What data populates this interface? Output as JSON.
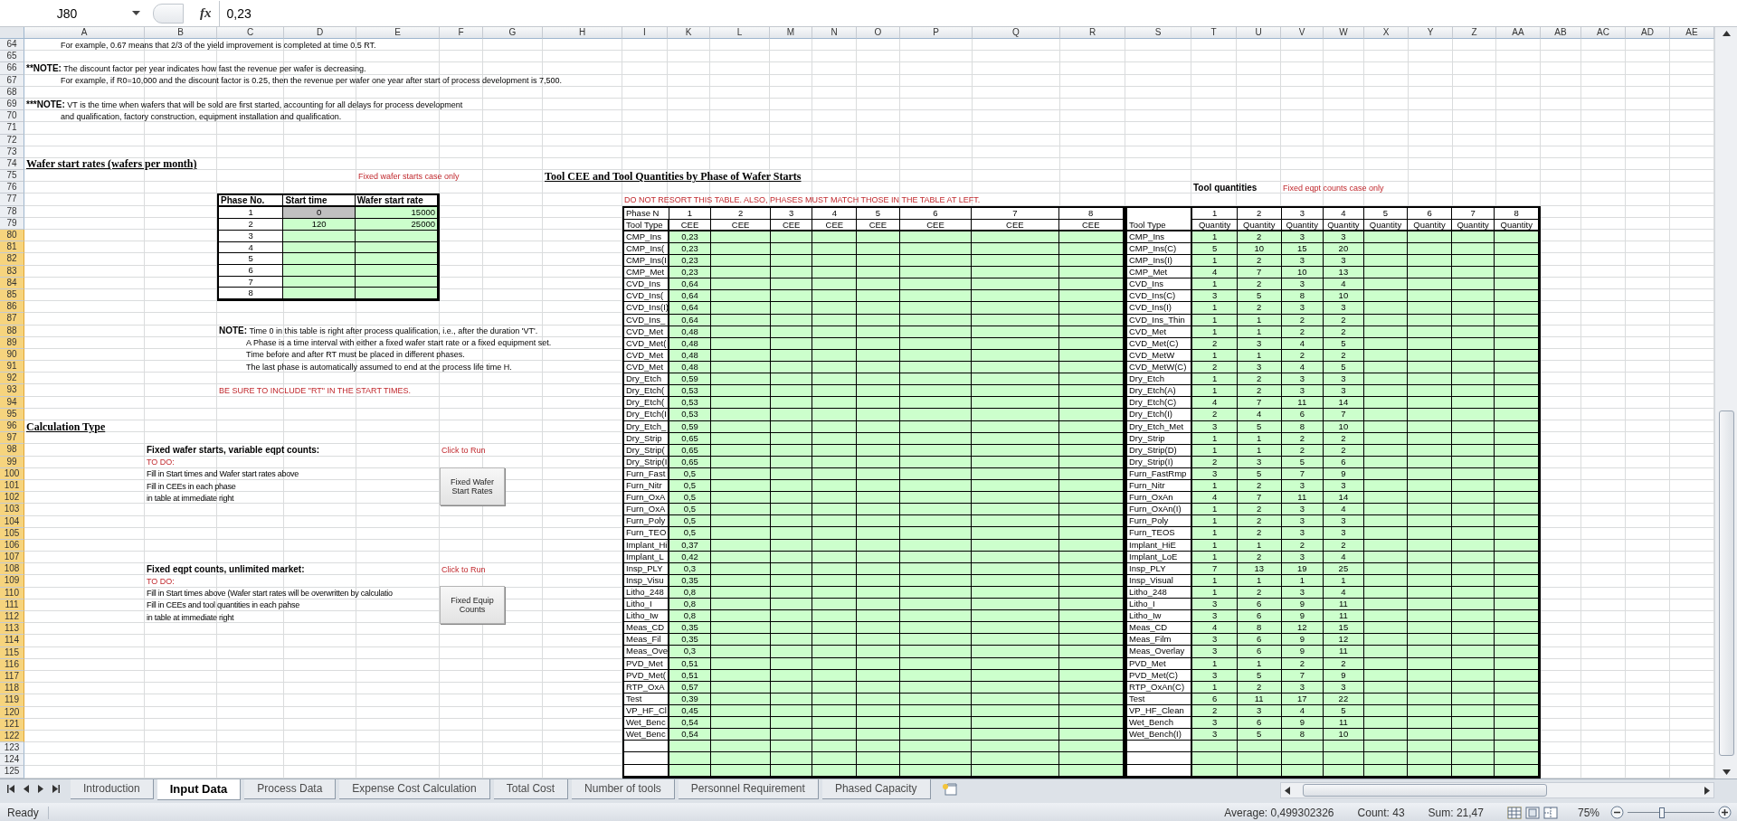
{
  "formula_bar": {
    "name_box": "J80",
    "function_label": "fx",
    "value": "0,23"
  },
  "columns": [
    "A",
    "B",
    "C",
    "D",
    "E",
    "F",
    "G",
    "H",
    "I",
    "K",
    "L",
    "M",
    "N",
    "O",
    "P",
    "Q",
    "R",
    "S",
    "T",
    "U",
    "V",
    "W",
    "X",
    "Y",
    "Z",
    "AA",
    "AB",
    "AC",
    "AD",
    "AE"
  ],
  "row_headers": [
    {
      "label": "64",
      "selected": false
    },
    {
      "label": "65",
      "selected": false
    },
    {
      "label": "66",
      "selected": false
    },
    {
      "label": "67",
      "selected": false
    },
    {
      "label": "68",
      "selected": false
    },
    {
      "label": "69",
      "selected": false
    },
    {
      "label": "70",
      "selected": false
    },
    {
      "label": "71",
      "selected": false
    },
    {
      "label": "72",
      "selected": false
    },
    {
      "label": "73",
      "selected": false
    },
    {
      "label": "74",
      "selected": false
    },
    {
      "label": "75",
      "selected": false
    },
    {
      "label": "76",
      "selected": false
    },
    {
      "label": "77",
      "selected": false
    },
    {
      "label": "78",
      "selected": false
    },
    {
      "label": "79",
      "selected": false
    },
    {
      "label": "80",
      "selected": true
    },
    {
      "label": "81",
      "selected": true
    },
    {
      "label": "82",
      "selected": true
    },
    {
      "label": "83",
      "selected": true
    },
    {
      "label": "84",
      "selected": true
    },
    {
      "label": "85",
      "selected": true
    },
    {
      "label": "86",
      "selected": true
    },
    {
      "label": "87",
      "selected": true
    },
    {
      "label": "88",
      "selected": true
    },
    {
      "label": "89",
      "selected": true
    },
    {
      "label": "90",
      "selected": true
    },
    {
      "label": "91",
      "selected": true
    },
    {
      "label": "92",
      "selected": true
    },
    {
      "label": "93",
      "selected": true
    },
    {
      "label": "94",
      "selected": true
    },
    {
      "label": "95",
      "selected": true
    },
    {
      "label": "96",
      "selected": true
    },
    {
      "label": "97",
      "selected": true
    },
    {
      "label": "98",
      "selected": true
    },
    {
      "label": "99",
      "selected": true
    },
    {
      "label": "100",
      "selected": true
    },
    {
      "label": "101",
      "selected": true
    },
    {
      "label": "102",
      "selected": true
    },
    {
      "label": "103",
      "selected": true
    },
    {
      "label": "104",
      "selected": true
    },
    {
      "label": "105",
      "selected": true
    },
    {
      "label": "106",
      "selected": true
    },
    {
      "label": "107",
      "selected": true
    },
    {
      "label": "108",
      "selected": true
    },
    {
      "label": "109",
      "selected": true
    },
    {
      "label": "110",
      "selected": true
    },
    {
      "label": "111",
      "selected": true
    },
    {
      "label": "112",
      "selected": true
    },
    {
      "label": "113",
      "selected": true
    },
    {
      "label": "114",
      "selected": true
    },
    {
      "label": "115",
      "selected": true
    },
    {
      "label": "116",
      "selected": true
    },
    {
      "label": "117",
      "selected": true
    },
    {
      "label": "118",
      "selected": true
    },
    {
      "label": "119",
      "selected": true
    },
    {
      "label": "120",
      "selected": true
    },
    {
      "label": "121",
      "selected": true
    },
    {
      "label": "122",
      "selected": true
    },
    {
      "label": "123",
      "selected": false
    },
    {
      "label": "124",
      "selected": false
    },
    {
      "label": "125",
      "selected": false
    }
  ],
  "notes": [
    {
      "kind": "indent",
      "text": "For example, 0.67 means that 2/3 of the yield improvement is completed at time 0.5 RT."
    },
    {
      "kind": "note",
      "mark": "**",
      "label": "NOTE:",
      "text": "The discount factor per year indicates how fast the revenue per wafer is decreasing."
    },
    {
      "kind": "indent",
      "text": "For example, if R0=10,000 and the discount factor is 0.25, then the revenue per wafer one year after start of process development is 7,500."
    },
    {
      "kind": "note",
      "mark": "***",
      "label": "NOTE:",
      "text": "VT is the time when wafers that will be sold are first started, accounting for all delays for process development"
    },
    {
      "kind": "indent",
      "text": "and qualification, factory construction, equipment installation and qualification."
    }
  ],
  "wafer_section": {
    "title": "Wafer start rates (wafers per month)",
    "case_note": "Fixed wafer starts case only",
    "table": {
      "columns": [
        "Phase No.",
        "Start time",
        "Wafer start rate"
      ],
      "rows": [
        {
          "phase": "1",
          "start": "0",
          "rate": "15000",
          "locked": true
        },
        {
          "phase": "2",
          "start": "120",
          "rate": "25000",
          "locked": false
        },
        {
          "phase": "3",
          "locked": false
        },
        {
          "phase": "4",
          "locked": false
        },
        {
          "phase": "5",
          "locked": false
        },
        {
          "phase": "6",
          "locked": false
        },
        {
          "phase": "7",
          "locked": false
        },
        {
          "phase": "8",
          "locked": false
        }
      ]
    },
    "note": {
      "label": "NOTE:",
      "lines": [
        "Time 0 in this table is right after process qualification, i.e., after the duration 'VT'.",
        "A Phase is a time interval with either a fixed wafer start rate or a fixed equipment set.",
        "Time before and after RT must be placed in different phases.",
        "The last phase is automatically assumed to end at the process life time H."
      ]
    },
    "warning": "BE SURE TO INCLUDE \"RT\" IN THE START TIMES."
  },
  "calculation": {
    "title": "Calculation Type",
    "cases": [
      {
        "title": "Fixed wafer starts, variable eqpt counts:",
        "run_label": "Click to Run",
        "todo": "TO DO:",
        "steps": [
          "Fill in Start times and Wafer start rates above",
          "Fill in CEEs in each phase",
          "in table at immediate right"
        ],
        "button": "Fixed Wafer Start Rates"
      },
      {
        "title": "Fixed eqpt counts, unlimited market:",
        "run_label": "Click to Run",
        "todo": "TO DO:",
        "steps": [
          "Fill in Start times above (Wafer start rates will be overwritten by calculatio",
          "Fill in CEEs and tool quantities in each pahse",
          "in table at immediate right"
        ],
        "button": "Fixed Equip Counts"
      }
    ]
  },
  "cee_section": {
    "title": "Tool CEE and Tool Quantities by Phase of Wafer Starts",
    "warning": "DO NOT RESORT THIS TABLE. ALSO, PHASES MUST MATCH THOSE IN THE TABLE AT LEFT.",
    "phase_label": "Phase N",
    "tool_label": "Tool Type",
    "phases": [
      {
        "number": "1",
        "unit": "CEE"
      },
      {
        "number": "2",
        "unit": "CEE"
      },
      {
        "number": "3",
        "unit": "CEE"
      },
      {
        "number": "4",
        "unit": "CEE"
      },
      {
        "number": "5",
        "unit": "CEE"
      },
      {
        "number": "6",
        "unit": "CEE"
      },
      {
        "number": "7",
        "unit": "CEE"
      },
      {
        "number": "8",
        "unit": "CEE"
      }
    ],
    "rows": [
      {
        "tool": "CMP_Ins",
        "cee": "0,23"
      },
      {
        "tool": "CMP_Ins(",
        "cee": "0,23"
      },
      {
        "tool": "CMP_Ins(I",
        "cee": "0,23"
      },
      {
        "tool": "CMP_Met",
        "cee": "0,23"
      },
      {
        "tool": "CVD_Ins",
        "cee": "0,64"
      },
      {
        "tool": "CVD_Ins(",
        "cee": "0,64"
      },
      {
        "tool": "CVD_Ins(I)",
        "cee": "0,64"
      },
      {
        "tool": "CVD_Ins_",
        "cee": "0,64"
      },
      {
        "tool": "CVD_Met",
        "cee": "0,48"
      },
      {
        "tool": "CVD_Met(",
        "cee": "0,48"
      },
      {
        "tool": "CVD_Met",
        "cee": "0,48"
      },
      {
        "tool": "CVD_Met",
        "cee": "0,48"
      },
      {
        "tool": "Dry_Etch",
        "cee": "0,59"
      },
      {
        "tool": "Dry_Etch(",
        "cee": "0,53"
      },
      {
        "tool": "Dry_Etch(",
        "cee": "0,53"
      },
      {
        "tool": "Dry_Etch(I",
        "cee": "0,53"
      },
      {
        "tool": "Dry_Etch_",
        "cee": "0,59"
      },
      {
        "tool": "Dry_Strip",
        "cee": "0,65"
      },
      {
        "tool": "Dry_Strip(",
        "cee": "0,65"
      },
      {
        "tool": "Dry_Strip(I",
        "cee": "0,65"
      },
      {
        "tool": "Furn_Fast",
        "cee": "0,5"
      },
      {
        "tool": "Furn_Nitr",
        "cee": "0,5"
      },
      {
        "tool": "Furn_OxA",
        "cee": "0,5"
      },
      {
        "tool": "Furn_OxA",
        "cee": "0,5"
      },
      {
        "tool": "Furn_Poly",
        "cee": "0,5"
      },
      {
        "tool": "Furn_TEO",
        "cee": "0,5"
      },
      {
        "tool": "Implant_Hi",
        "cee": "0,37"
      },
      {
        "tool": "Implant_L",
        "cee": "0,42"
      },
      {
        "tool": "Insp_PLY",
        "cee": "0,3"
      },
      {
        "tool": "Insp_Visu",
        "cee": "0,35"
      },
      {
        "tool": "Litho_248",
        "cee": "0,8"
      },
      {
        "tool": "Litho_I",
        "cee": "0,8"
      },
      {
        "tool": "Litho_Iw",
        "cee": "0,8"
      },
      {
        "tool": "Meas_CD",
        "cee": "0,35"
      },
      {
        "tool": "Meas_Fil",
        "cee": "0,35"
      },
      {
        "tool": "Meas_Ove",
        "cee": "0,3"
      },
      {
        "tool": "PVD_Met",
        "cee": "0,51"
      },
      {
        "tool": "PVD_Met(",
        "cee": "0,51"
      },
      {
        "tool": "RTP_OxA",
        "cee": "0,57"
      },
      {
        "tool": "Test",
        "cee": "0,39"
      },
      {
        "tool": "VP_HF_Cl",
        "cee": "0,45"
      },
      {
        "tool": "Wet_Benc",
        "cee": "0,54"
      },
      {
        "tool": "Wet_Benc",
        "cee": "0,54"
      }
    ]
  },
  "quantity_section": {
    "title": "Tool quantities",
    "case_note": "Fixed eqpt counts case only",
    "tool_label": "Tool Type",
    "phases": [
      {
        "number": "1",
        "unit": "Quantity"
      },
      {
        "number": "2",
        "unit": "Quantity"
      },
      {
        "number": "3",
        "unit": "Quantity"
      },
      {
        "number": "4",
        "unit": "Quantity"
      },
      {
        "number": "5",
        "unit": "Quantity"
      },
      {
        "number": "6",
        "unit": "Quantity"
      },
      {
        "number": "7",
        "unit": "Quantity"
      },
      {
        "number": "8",
        "unit": "Quantity"
      }
    ],
    "rows": [
      {
        "tool": "CMP_Ins",
        "quantities": [
          "1",
          "2",
          "3",
          "3"
        ]
      },
      {
        "tool": "CMP_Ins(C)",
        "quantities": [
          "5",
          "10",
          "15",
          "20"
        ]
      },
      {
        "tool": "CMP_Ins(I)",
        "quantities": [
          "1",
          "2",
          "3",
          "3"
        ]
      },
      {
        "tool": "CMP_Met",
        "quantities": [
          "4",
          "7",
          "10",
          "13"
        ]
      },
      {
        "tool": "CVD_Ins",
        "quantities": [
          "1",
          "2",
          "3",
          "4"
        ]
      },
      {
        "tool": "CVD_Ins(C)",
        "quantities": [
          "3",
          "5",
          "8",
          "10"
        ]
      },
      {
        "tool": "CVD_Ins(I)",
        "quantities": [
          "1",
          "2",
          "3",
          "3"
        ]
      },
      {
        "tool": "CVD_Ins_Thin",
        "quantities": [
          "1",
          "1",
          "2",
          "2"
        ]
      },
      {
        "tool": "CVD_Met",
        "quantities": [
          "1",
          "1",
          "2",
          "2"
        ]
      },
      {
        "tool": "CVD_Met(C)",
        "quantities": [
          "2",
          "3",
          "4",
          "5"
        ]
      },
      {
        "tool": "CVD_MetW",
        "quantities": [
          "1",
          "1",
          "2",
          "2"
        ]
      },
      {
        "tool": "CVD_MetW(C)",
        "quantities": [
          "2",
          "3",
          "4",
          "5"
        ]
      },
      {
        "tool": "Dry_Etch",
        "quantities": [
          "1",
          "2",
          "3",
          "3"
        ]
      },
      {
        "tool": "Dry_Etch(A)",
        "quantities": [
          "1",
          "2",
          "3",
          "3"
        ]
      },
      {
        "tool": "Dry_Etch(C)",
        "quantities": [
          "4",
          "7",
          "11",
          "14"
        ]
      },
      {
        "tool": "Dry_Etch(I)",
        "quantities": [
          "2",
          "4",
          "6",
          "7"
        ]
      },
      {
        "tool": "Dry_Etch_Met",
        "quantities": [
          "3",
          "5",
          "8",
          "10"
        ]
      },
      {
        "tool": "Dry_Strip",
        "quantities": [
          "1",
          "1",
          "2",
          "2"
        ]
      },
      {
        "tool": "Dry_Strip(D)",
        "quantities": [
          "1",
          "1",
          "2",
          "2"
        ]
      },
      {
        "tool": "Dry_Strip(I)",
        "quantities": [
          "2",
          "3",
          "5",
          "6"
        ]
      },
      {
        "tool": "Furn_FastRmp",
        "quantities": [
          "3",
          "5",
          "7",
          "9"
        ]
      },
      {
        "tool": "Furn_Nitr",
        "quantities": [
          "1",
          "2",
          "3",
          "3"
        ]
      },
      {
        "tool": "Furn_OxAn",
        "quantities": [
          "4",
          "7",
          "11",
          "14"
        ]
      },
      {
        "tool": "Furn_OxAn(I)",
        "quantities": [
          "1",
          "2",
          "3",
          "4"
        ]
      },
      {
        "tool": "Furn_Poly",
        "quantities": [
          "1",
          "2",
          "3",
          "3"
        ]
      },
      {
        "tool": "Furn_TEOS",
        "quantities": [
          "1",
          "2",
          "3",
          "3"
        ]
      },
      {
        "tool": "Implant_HiE",
        "quantities": [
          "1",
          "1",
          "2",
          "2"
        ]
      },
      {
        "tool": "Implant_LoE",
        "quantities": [
          "1",
          "2",
          "3",
          "4"
        ]
      },
      {
        "tool": "Insp_PLY",
        "quantities": [
          "7",
          "13",
          "19",
          "25"
        ]
      },
      {
        "tool": "Insp_Visual",
        "quantities": [
          "1",
          "1",
          "1",
          "1"
        ]
      },
      {
        "tool": "Litho_248",
        "quantities": [
          "1",
          "2",
          "3",
          "4"
        ]
      },
      {
        "tool": "Litho_I",
        "quantities": [
          "3",
          "6",
          "9",
          "11"
        ]
      },
      {
        "tool": "Litho_Iw",
        "quantities": [
          "3",
          "6",
          "9",
          "11"
        ]
      },
      {
        "tool": "Meas_CD",
        "quantities": [
          "4",
          "8",
          "12",
          "15"
        ]
      },
      {
        "tool": "Meas_Film",
        "quantities": [
          "3",
          "6",
          "9",
          "12"
        ]
      },
      {
        "tool": "Meas_Overlay",
        "quantities": [
          "3",
          "6",
          "9",
          "11"
        ]
      },
      {
        "tool": "PVD_Met",
        "quantities": [
          "1",
          "1",
          "2",
          "2"
        ]
      },
      {
        "tool": "PVD_Met(C)",
        "quantities": [
          "3",
          "5",
          "7",
          "9"
        ]
      },
      {
        "tool": "RTP_OxAn(C)",
        "quantities": [
          "1",
          "2",
          "3",
          "3"
        ]
      },
      {
        "tool": "Test",
        "quantities": [
          "6",
          "11",
          "17",
          "22"
        ]
      },
      {
        "tool": "VP_HF_Clean",
        "quantities": [
          "2",
          "3",
          "4",
          "5"
        ]
      },
      {
        "tool": "Wet_Bench",
        "quantities": [
          "3",
          "6",
          "9",
          "11"
        ]
      },
      {
        "tool": "Wet_Bench(I)",
        "quantities": [
          "3",
          "5",
          "8",
          "10"
        ]
      }
    ]
  },
  "sheet_tabs": [
    {
      "label": "Introduction",
      "selected": false
    },
    {
      "label": "Input Data",
      "selected": true
    },
    {
      "label": "Process Data",
      "selected": false
    },
    {
      "label": "Expense Cost Calculation",
      "selected": false
    },
    {
      "label": "Total Cost",
      "selected": false
    },
    {
      "label": "Number of tools",
      "selected": false
    },
    {
      "label": "Personnel Requirement",
      "selected": false
    },
    {
      "label": "Phased Capacity",
      "selected": false
    }
  ],
  "status_bar": {
    "state": "Ready",
    "average": "Average: 0,499302326",
    "count": "Count: 43",
    "sum": "Sum: 21,47",
    "zoom": "75%",
    "zoom_slider": {
      "level": 0.4
    }
  }
}
